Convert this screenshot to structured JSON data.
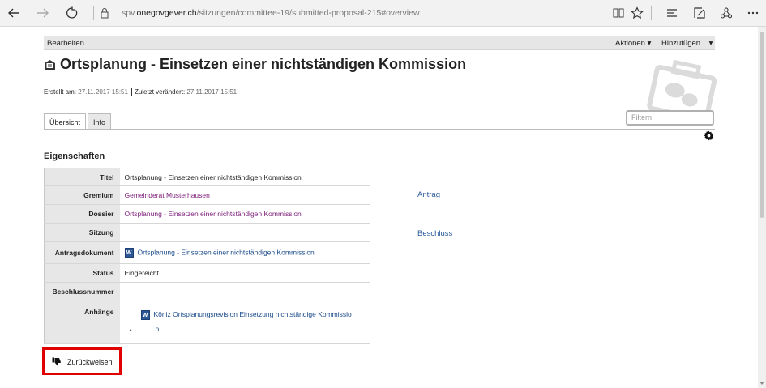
{
  "browser": {
    "url_prefix": "spv.",
    "url_domain": "onegovgever.ch",
    "url_path": "/sitzungen/committee-19/submitted-proposal-215#overview"
  },
  "topbar": {
    "edit_label": "Bearbeiten",
    "actions_label": "Aktionen ▾",
    "add_label": "Hinzufügen... ▾"
  },
  "document": {
    "title": "Ortsplanung - Einsetzen einer nichtständigen Kommission",
    "created_label": "Erstellt am:",
    "created_value": "27.11.2017 15:51",
    "modified_label": "Zuletzt verändert:",
    "modified_value": "27.11.2017 15:51"
  },
  "tabs": [
    {
      "label": "Übersicht",
      "active": true
    },
    {
      "label": "Info",
      "active": false
    }
  ],
  "filter": {
    "placeholder": "Filtern"
  },
  "properties": {
    "section_title": "Eigenschaften",
    "rows": [
      {
        "key": "Titel",
        "value": "Ortsplanung - Einsetzen einer nichtständigen Kommission"
      },
      {
        "key": "Gremium",
        "value": "Gemeinderat Musterhausen"
      },
      {
        "key": "Dossier",
        "value": "Ortsplanung - Einsetzen einer nichtständigen Kommission"
      },
      {
        "key": "Sitzung",
        "value": ""
      },
      {
        "key": "Antragsdokument",
        "value": "Ortsplanung - Einsetzen einer nichtständigen Kommission"
      },
      {
        "key": "Status",
        "value": "Eingereicht"
      },
      {
        "key": "Beschlussnummer",
        "value": ""
      },
      {
        "key": "Anhänge",
        "value_line1": "Köniz Ortsplanungsrevision Einsetzung nichtständige Kommissio",
        "value_line2": "n"
      }
    ]
  },
  "side_links": {
    "antrag": "Antrag",
    "beschluss": "Beschluss"
  },
  "reject_button": {
    "label": "Zurückweisen"
  },
  "colors": {
    "link": "#1a4a8a",
    "visited_link": "#7a1a78",
    "highlight_border": "#e00000"
  }
}
